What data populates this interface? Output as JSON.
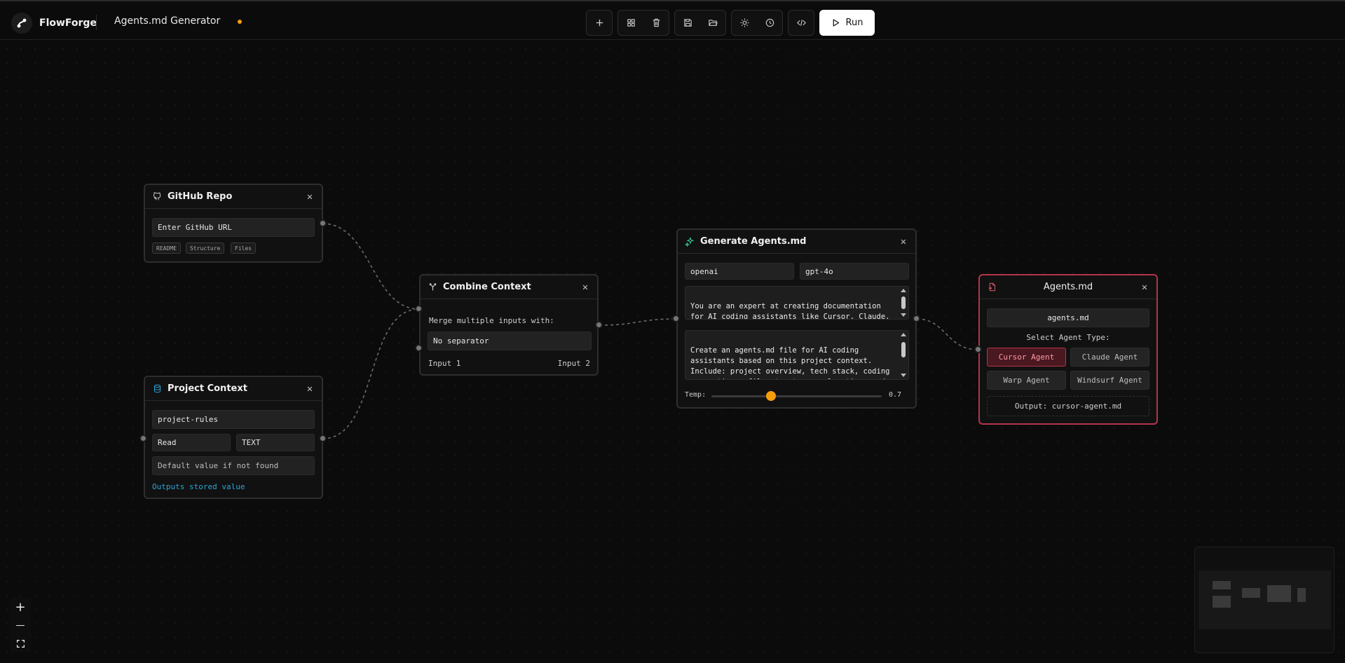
{
  "app": {
    "brand": "FlowForge",
    "document_title": "Agents.md Generator",
    "unsaved_indicator_color": "#f59e0b"
  },
  "toolbar": {
    "buttons": [
      "add-icon",
      "layout-grid-icon",
      "trash-icon",
      "save-icon",
      "folder-open-icon",
      "sun-icon",
      "history-icon",
      "code-icon"
    ],
    "run_label": "Run"
  },
  "nodes": {
    "github": {
      "title": "GitHub Repo",
      "url_placeholder": "Enter GitHub URL",
      "chips": [
        "README",
        "Structure",
        "Files"
      ]
    },
    "project": {
      "title": "Project Context",
      "key_value": "project-rules",
      "mode_value": "Read",
      "type_value": "TEXT",
      "default_placeholder": "Default value if not found",
      "hint": "Outputs stored value",
      "hint_color": "#2aa6d8"
    },
    "combine": {
      "title": "Combine Context",
      "description": "Merge multiple inputs with:",
      "separator_value": "No separator",
      "input1": "Input 1",
      "input2": "Input 2"
    },
    "generate": {
      "title": "Generate Agents.md",
      "provider": "openai",
      "model": "gpt-4o",
      "system_prompt": "You are an expert at creating documentation for AI coding assistants like Cursor, Claude, Windsurf, and Warp.",
      "user_prompt": "Create an agents.md file for AI coding assistants based on this project context. Include: project overview, tech stack, coding conventions, file structure explanation, and specific guidelines for the AI agent.",
      "temp_label": "Temp:",
      "temperature": 0.7,
      "temperature_display": "0.7",
      "slider_color": "#f59e0b"
    },
    "agents": {
      "title": "Agents.md",
      "filename": "agents.md",
      "select_label": "Select Agent Type:",
      "options": [
        "Cursor Agent",
        "Claude Agent",
        "Warp Agent",
        "Windsurf Agent"
      ],
      "selected": "Cursor Agent",
      "output": "Output: cursor-agent.md",
      "accent_color": "#b4344a"
    }
  },
  "canvas_controls": {
    "zoom_in": "+",
    "zoom_out": "—",
    "fit_view": "fit-view-icon"
  }
}
